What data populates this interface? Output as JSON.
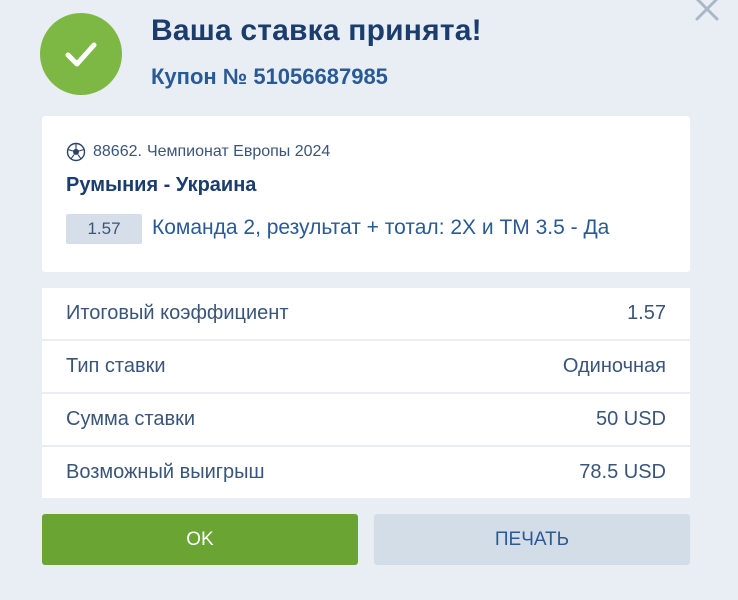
{
  "header": {
    "title": "Ваша ставка принята!",
    "coupon_label": "Купон №",
    "coupon_number": "51056687985"
  },
  "event": {
    "league_id": "88662.",
    "league_name": "Чемпионат Европы 2024",
    "match": "Румыния - Украина",
    "odds": "1.57",
    "outcome": "Команда 2, результат + тотал: 2X и ТМ 3.5 - Да",
    "sport_icon": "soccer-ball-icon"
  },
  "summary": [
    {
      "label": "Итоговый коэффициент",
      "value": "1.57"
    },
    {
      "label": "Тип ставки",
      "value": "Одиночная"
    },
    {
      "label": "Сумма ставки",
      "value": "50 USD"
    },
    {
      "label": "Возможный выигрыш",
      "value": "78.5 USD"
    }
  ],
  "buttons": {
    "ok": "OK",
    "print": "ПЕЧАТЬ"
  },
  "colors": {
    "background": "#e9eef4",
    "success_green": "#7db844",
    "ok_button": "#6aa534",
    "print_button": "#d3dde8",
    "title_blue": "#1a3d6e",
    "text_blue": "#2a5a96"
  }
}
